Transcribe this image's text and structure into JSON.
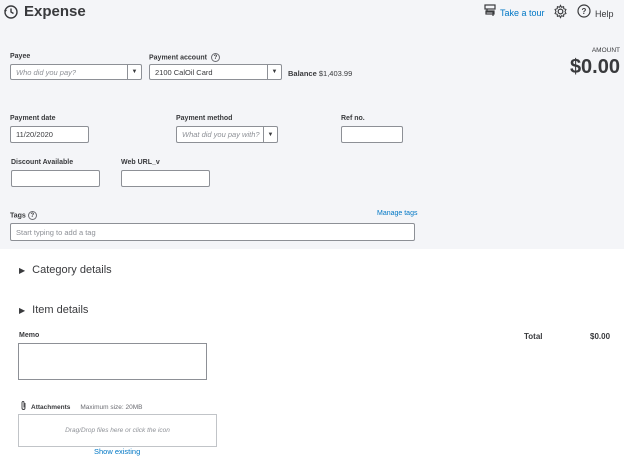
{
  "header": {
    "title": "Expense",
    "take_tour": "Take a tour",
    "help": "Help"
  },
  "payee": {
    "label": "Payee",
    "placeholder": "Who did you pay?"
  },
  "payment_account": {
    "label": "Payment account",
    "value": "2100 CalOil Card",
    "balance_label": "Balance",
    "balance_value": "$1,403.99"
  },
  "amount": {
    "label": "AMOUNT",
    "value": "$0.00"
  },
  "payment_date": {
    "label": "Payment date",
    "value": "11/20/2020"
  },
  "payment_method": {
    "label": "Payment method",
    "placeholder": "What did you pay with?"
  },
  "ref_no": {
    "label": "Ref no.",
    "value": ""
  },
  "discount": {
    "label": "Discount Available",
    "value": ""
  },
  "web_url": {
    "label": "Web URL_v",
    "value": ""
  },
  "tags": {
    "label": "Tags",
    "manage": "Manage tags",
    "placeholder": "Start typing to add a tag"
  },
  "sections": {
    "category": "Category details",
    "item": "Item details"
  },
  "memo": {
    "label": "Memo"
  },
  "total": {
    "label": "Total",
    "value": "$0.00"
  },
  "attachments": {
    "label": "Attachments",
    "max_size": "Maximum size: 20MB",
    "drop_text": "Drag/Drop files here or click the icon",
    "show_existing": "Show existing"
  }
}
